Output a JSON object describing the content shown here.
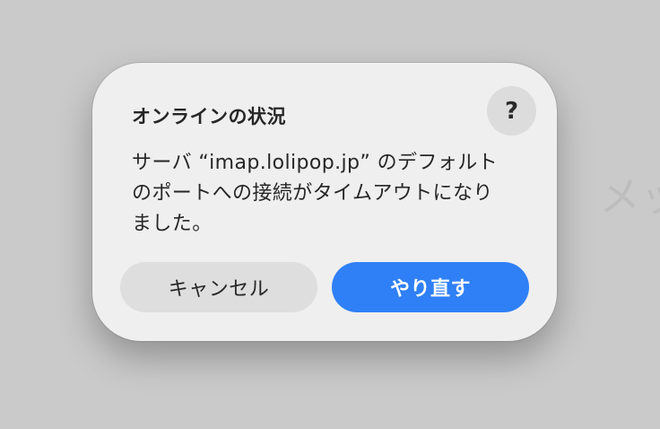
{
  "background": {
    "partial_text": "メッ"
  },
  "dialog": {
    "title": "オンラインの状況",
    "help_label": "?",
    "message": "サーバ “imap.lolipop.jp” のデフォルトのポートへの接続がタイムアウトになりました。",
    "cancel_label": "キャンセル",
    "retry_label": "やり直す"
  },
  "colors": {
    "accent": "#2f80f6",
    "dialog_background": "#efefef",
    "page_background": "#cacaca"
  }
}
